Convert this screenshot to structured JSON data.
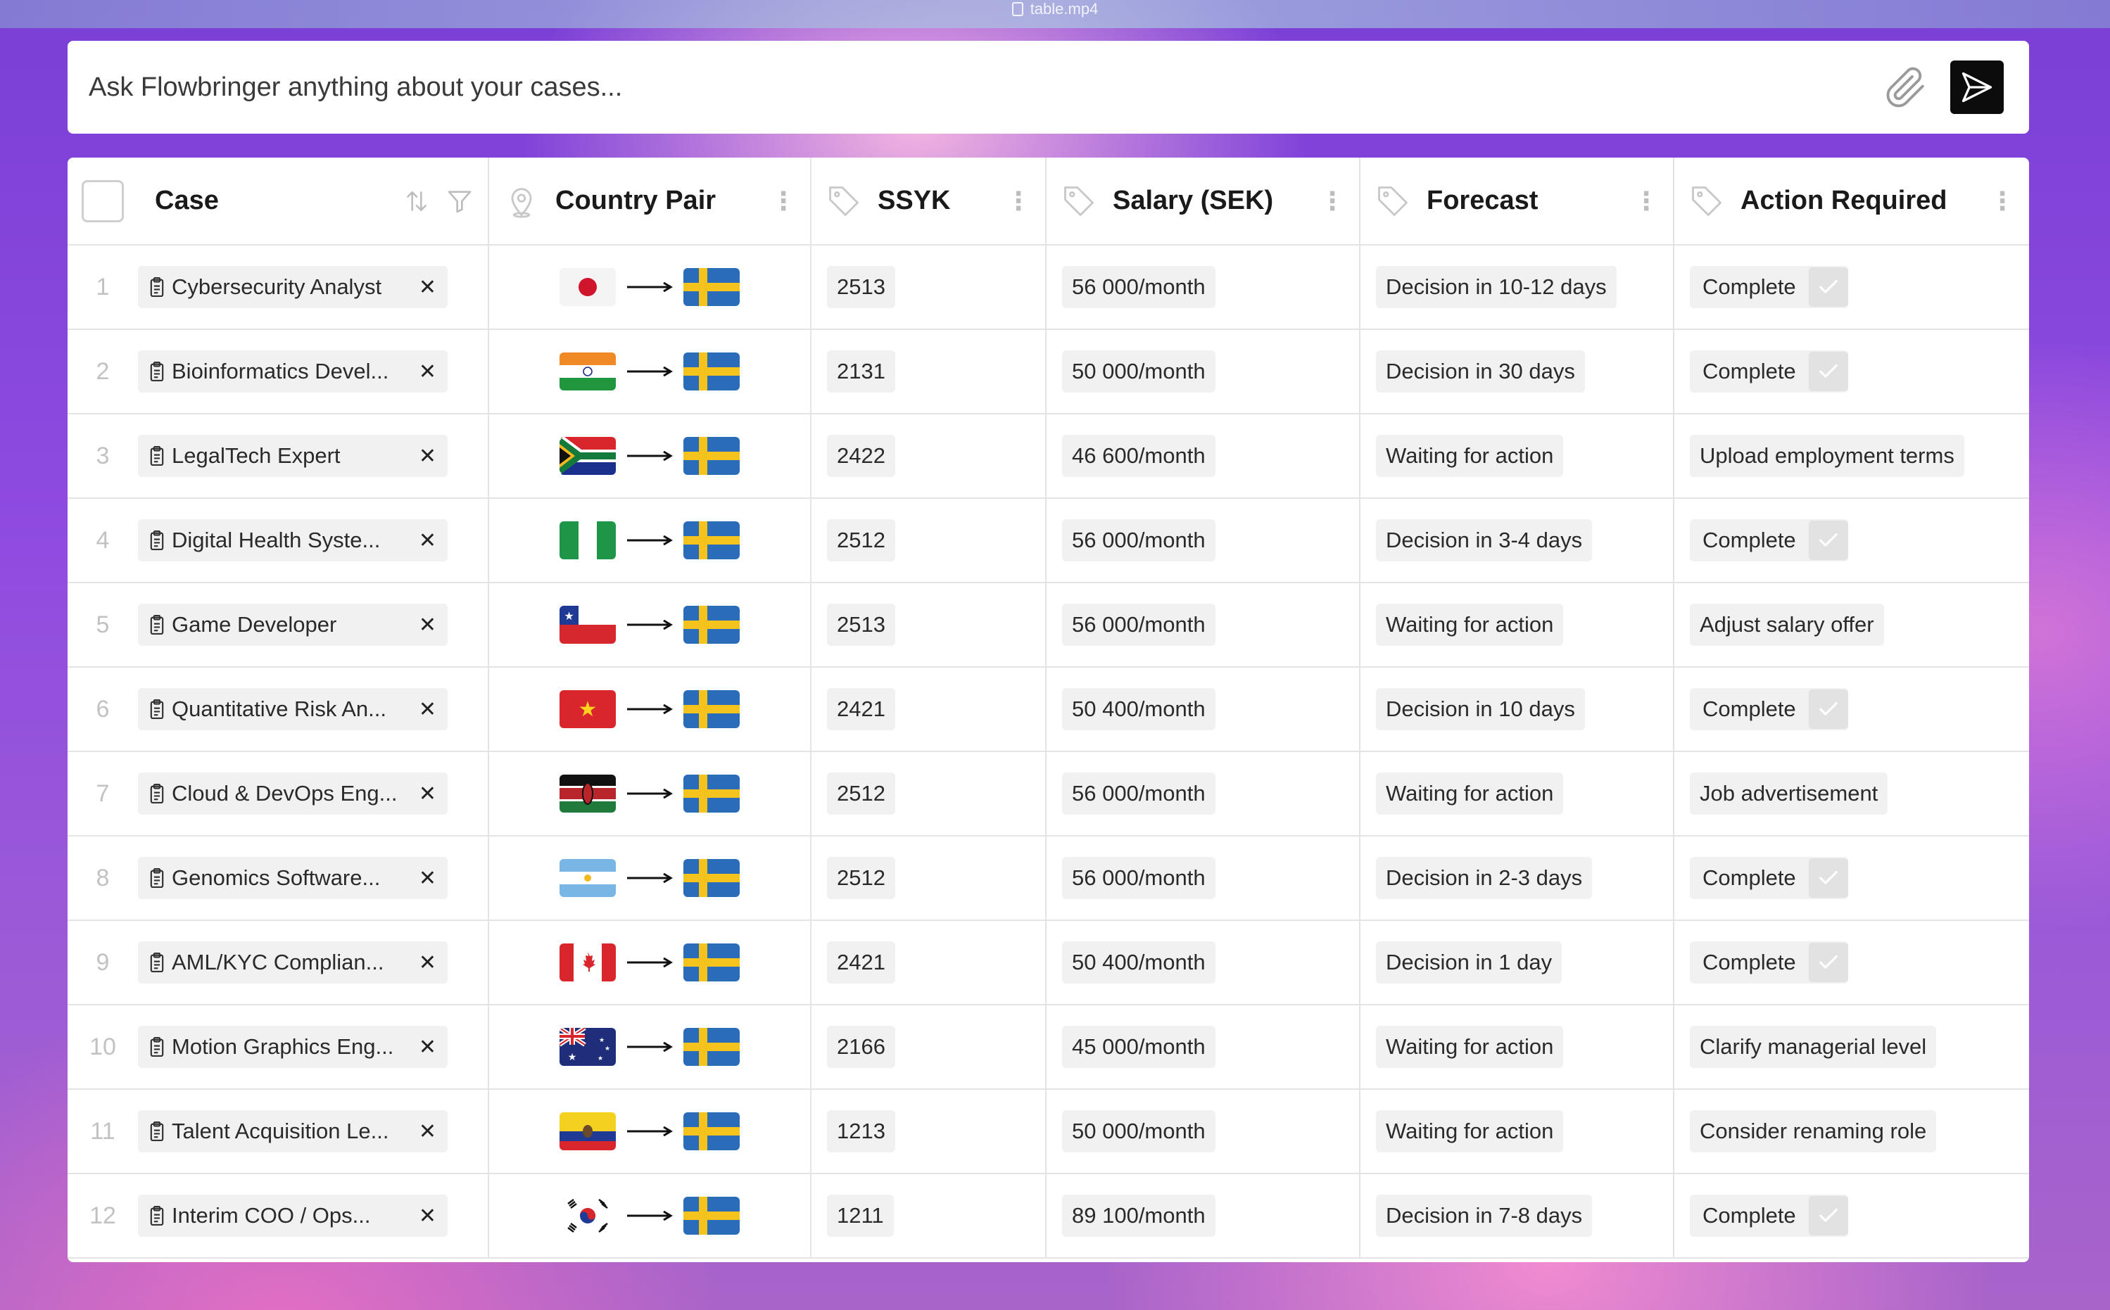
{
  "window": {
    "file_title": "table.mp4"
  },
  "search": {
    "placeholder": "Ask Flowbringer anything about your cases..."
  },
  "columns": {
    "case": "Case",
    "country_pair": "Country Pair",
    "ssyk": "SSYK",
    "salary": "Salary (SEK)",
    "forecast": "Forecast",
    "action": "Action Required"
  },
  "rows": [
    {
      "num": "1",
      "case": "Cybersecurity Analyst",
      "from": "japan-flag",
      "ssyk": "2513",
      "salary": "56 000/month",
      "forecast": "Decision in 10-12 days",
      "action": "Complete",
      "complete": true
    },
    {
      "num": "2",
      "case": "Bioinformatics Devel...",
      "from": "india-flag",
      "ssyk": "2131",
      "salary": "50 000/month",
      "forecast": "Decision in 30 days",
      "action": "Complete",
      "complete": true
    },
    {
      "num": "3",
      "case": "LegalTech Expert",
      "from": "south-africa-flag",
      "ssyk": "2422",
      "salary": "46 600/month",
      "forecast": "Waiting for action",
      "action": "Upload employment terms",
      "complete": false
    },
    {
      "num": "4",
      "case": "Digital Health Syste...",
      "from": "nigeria-flag",
      "ssyk": "2512",
      "salary": "56 000/month",
      "forecast": "Decision in 3-4 days",
      "action": "Complete",
      "complete": true
    },
    {
      "num": "5",
      "case": "Game Developer",
      "from": "chile-flag",
      "ssyk": "2513",
      "salary": "56 000/month",
      "forecast": "Waiting for action",
      "action": "Adjust salary offer",
      "complete": false
    },
    {
      "num": "6",
      "case": "Quantitative Risk An...",
      "from": "vietnam-flag",
      "ssyk": "2421",
      "salary": "50 400/month",
      "forecast": "Decision in 10 days",
      "action": "Complete",
      "complete": true
    },
    {
      "num": "7",
      "case": "Cloud & DevOps Eng...",
      "from": "kenya-flag",
      "ssyk": "2512",
      "salary": "56 000/month",
      "forecast": "Waiting for action",
      "action": "Job advertisement",
      "complete": false
    },
    {
      "num": "8",
      "case": "Genomics Software...",
      "from": "argentina-flag",
      "ssyk": "2512",
      "salary": "56 000/month",
      "forecast": "Decision in 2-3 days",
      "action": "Complete",
      "complete": true
    },
    {
      "num": "9",
      "case": "AML/KYC Complian...",
      "from": "canada-flag",
      "ssyk": "2421",
      "salary": "50 400/month",
      "forecast": "Decision in 1 day",
      "action": "Complete",
      "complete": true
    },
    {
      "num": "10",
      "case": "Motion Graphics Eng...",
      "from": "australia-flag",
      "ssyk": "2166",
      "salary": "45 000/month",
      "forecast": "Waiting for action",
      "action": "Clarify managerial level",
      "complete": false
    },
    {
      "num": "11",
      "case": "Talent Acquisition Le...",
      "from": "ecuador-flag",
      "ssyk": "1213",
      "salary": "50 000/month",
      "forecast": "Waiting for action",
      "action": "Consider renaming role",
      "complete": false
    },
    {
      "num": "12",
      "case": "Interim COO / Ops...",
      "from": "south-korea-flag",
      "ssyk": "1211",
      "salary": "89 100/month",
      "forecast": "Decision in 7-8 days",
      "action": "Complete",
      "complete": true
    }
  ],
  "destination": "sweden-flag"
}
